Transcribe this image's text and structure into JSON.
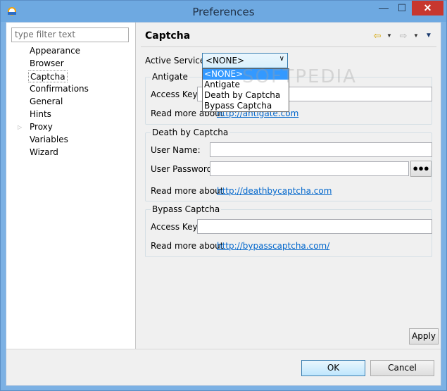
{
  "window": {
    "title": "Preferences",
    "minimize_glyph": "—",
    "maximize_glyph": "☐",
    "close_glyph": "✕"
  },
  "left_pane": {
    "filter_placeholder": "type filter text",
    "items": [
      {
        "label": "Appearance",
        "selected": false,
        "expandable": false
      },
      {
        "label": "Browser",
        "selected": false,
        "expandable": false
      },
      {
        "label": "Captcha",
        "selected": true,
        "expandable": false
      },
      {
        "label": "Confirmations",
        "selected": false,
        "expandable": false
      },
      {
        "label": "General",
        "selected": false,
        "expandable": false
      },
      {
        "label": "Hints",
        "selected": false,
        "expandable": false
      },
      {
        "label": "Proxy",
        "selected": false,
        "expandable": true
      },
      {
        "label": "Variables",
        "selected": false,
        "expandable": false
      },
      {
        "label": "Wizard",
        "selected": false,
        "expandable": false
      }
    ]
  },
  "page": {
    "title": "Captcha",
    "nav_icons": [
      "back-arrow-icon",
      "back-dropdown-icon",
      "forward-arrow-icon",
      "forward-dropdown-icon",
      "view-menu-icon"
    ],
    "active_service_label": "Active Service:",
    "active_service_value": "<NONE>",
    "dropdown_options": [
      "<NONE>",
      "Antigate",
      "Death by Captcha",
      "Bypass Captcha"
    ],
    "dropdown_highlighted": "<NONE>",
    "antigate": {
      "group_title": "Antigate",
      "access_key_label": "Access Key:",
      "access_key_value": "",
      "read_more_label": "Read more about",
      "link": "http://antigate.com"
    },
    "death_by_captcha": {
      "group_title": "Death by Captcha",
      "username_label": "User Name:",
      "username_value": "",
      "password_label": "User Password:",
      "password_value": "",
      "reveal_button": "●●●",
      "read_more_label": "Read more about",
      "link": "http://deathbycaptcha.com"
    },
    "bypass_captcha": {
      "group_title": "Bypass Captcha",
      "access_key_label": "Access Key:",
      "access_key_value": "",
      "read_more_label": "Read more about",
      "link": "http://bypasscaptcha.com/"
    },
    "apply_label": "Apply"
  },
  "footer": {
    "ok_label": "OK",
    "cancel_label": "Cancel"
  },
  "watermark": "SOFTPEDIA",
  "colors": {
    "title_bar": "#6ea9e1",
    "close_button": "#c7372f",
    "selection": "#3399ff",
    "link": "#0066cc"
  }
}
